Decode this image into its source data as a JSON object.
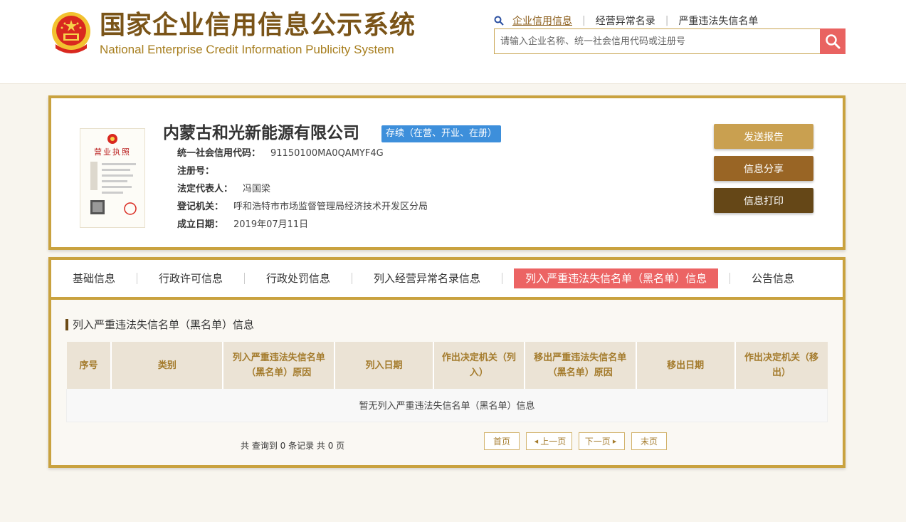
{
  "header": {
    "title_cn": "国家企业信用信息公示系统",
    "title_en": "National Enterprise Credit Information Publicity System",
    "links": [
      "企业信用信息",
      "经营异常名录",
      "严重违法失信名单"
    ],
    "search_placeholder": "请输入企业名称、统一社会信用代码或注册号"
  },
  "company": {
    "name": "内蒙古和光新能源有限公司",
    "status": "存续（在营、开业、在册）",
    "fields": [
      {
        "label": "统一社会信用代码：",
        "value": "91150100MA0QAMYF4G"
      },
      {
        "label": "注册号：",
        "value": ""
      },
      {
        "label": "法定代表人：",
        "value": "冯国梁"
      },
      {
        "label": "登记机关：",
        "value": "呼和浩特市市场监督管理局经济技术开发区分局"
      },
      {
        "label": "成立日期：",
        "value": "2019年07月11日"
      }
    ],
    "license_text": "营业执照"
  },
  "actions": {
    "report": "发送报告",
    "share": "信息分享",
    "print": "信息打印"
  },
  "tabs": [
    "基础信息",
    "行政许可信息",
    "行政处罚信息",
    "列入经营异常名录信息",
    "列入严重违法失信名单（黑名单）信息",
    "公告信息"
  ],
  "section": {
    "title": "列入严重违法失信名单（黑名单）信息",
    "columns": [
      "序号",
      "类别",
      "列入严重违法失信名单（黑名单）原因",
      "列入日期",
      "作出决定机关（列入）",
      "移出严重违法失信名单（黑名单）原因",
      "移出日期",
      "作出决定机关（移出）"
    ],
    "empty_text": "暂无列入严重违法失信名单（黑名单）信息"
  },
  "pagination": {
    "summary": "共 查询到 0 条记录 共 0 页",
    "first": "首页",
    "prev": "上一页",
    "next": "下一页",
    "last": "末页"
  },
  "colors": {
    "gold": "#c9a23f",
    "active_tab": "#ec6464",
    "badge": "#3d8fdb",
    "search_btn": "#e96361"
  }
}
